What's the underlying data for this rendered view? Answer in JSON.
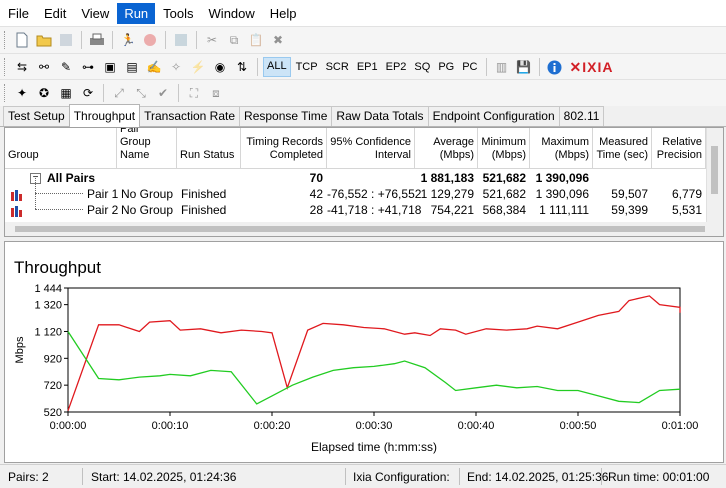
{
  "menu": [
    "File",
    "Edit",
    "View",
    "Run",
    "Tools",
    "Window",
    "Help"
  ],
  "toolbar2": {
    "all": "ALL",
    "tcp": "TCP",
    "scr": "SCR",
    "ep1": "EP1",
    "ep2": "EP2",
    "sq": "SQ",
    "pg": "PG",
    "pc": "PC",
    "brand": "IXIA"
  },
  "tabs": [
    "Test Setup",
    "Throughput",
    "Transaction Rate",
    "Response Time",
    "Raw Data Totals",
    "Endpoint Configuration",
    "802.11"
  ],
  "table": {
    "headers": {
      "group": "Group",
      "pair_group_name": "Pair Group Name",
      "run_status": "Run Status",
      "timing_records": "Timing Records Completed",
      "confidence": "95% Confidence Interval",
      "average": "Average (Mbps)",
      "minimum": "Minimum (Mbps)",
      "maximum": "Maximum (Mbps)",
      "measured_time": "Measured Time (sec)",
      "relative_precision": "Relative Precision"
    },
    "all_pairs": {
      "expander": "−",
      "label": "All Pairs",
      "timing_records": "70",
      "average": "1 881,183",
      "minimum": "521,682",
      "maximum": "1 390,096"
    },
    "pairs": [
      {
        "name": "Pair 1",
        "pair_group": "No Group",
        "status": "Finished",
        "records": "42",
        "confidence": "-76,552 : +76,552",
        "average": "1 129,279",
        "minimum": "521,682",
        "maximum": "1 390,096",
        "measured": "59,507",
        "precision": "6,779"
      },
      {
        "name": "Pair 2",
        "pair_group": "No Group",
        "status": "Finished",
        "records": "28",
        "confidence": "-41,718 : +41,718",
        "average": "754,221",
        "minimum": "568,384",
        "maximum": "1 111,111",
        "measured": "59,399",
        "precision": "5,531"
      }
    ]
  },
  "chart_data": {
    "type": "line",
    "title": "Throughput",
    "xlabel": "Elapsed time (h:mm:ss)",
    "ylabel": "Mbps",
    "xlim": [
      0,
      60
    ],
    "ylim": [
      520,
      1444
    ],
    "y_ticks": [
      "1 444",
      "1 320",
      "1 120",
      "920",
      "720",
      "520"
    ],
    "y_tick_values": [
      1444,
      1320,
      1120,
      920,
      720,
      520
    ],
    "x_ticks": [
      "0:00:00",
      "0:00:10",
      "0:00:20",
      "0:00:30",
      "0:00:40",
      "0:00:50",
      "0:01:00"
    ],
    "x_tick_values": [
      0,
      10,
      20,
      30,
      40,
      50,
      60
    ],
    "grid": false,
    "series": [
      {
        "color": "#e0191e",
        "points": [
          [
            0,
            530
          ],
          [
            3,
            1170
          ],
          [
            5,
            1170
          ],
          [
            7,
            1120
          ],
          [
            8,
            1190
          ],
          [
            10,
            1200
          ],
          [
            11,
            1130
          ],
          [
            13,
            1140
          ],
          [
            15,
            1110
          ],
          [
            17,
            1130
          ],
          [
            19,
            1120
          ],
          [
            20,
            1110
          ],
          [
            21.5,
            700
          ],
          [
            23.5,
            1130
          ],
          [
            25,
            1180
          ],
          [
            27,
            1170
          ],
          [
            29,
            1150
          ],
          [
            31,
            1140
          ],
          [
            33,
            1100
          ],
          [
            34,
            1110
          ],
          [
            35.5,
            1090
          ],
          [
            36.5,
            1140
          ],
          [
            38,
            1130
          ],
          [
            39,
            1100
          ],
          [
            41,
            1140
          ],
          [
            43,
            1130
          ],
          [
            45,
            1140
          ],
          [
            46,
            1160
          ],
          [
            48,
            1140
          ],
          [
            50,
            1190
          ],
          [
            52,
            1240
          ],
          [
            54,
            1270
          ],
          [
            55,
            1350
          ],
          [
            57,
            1385
          ],
          [
            58,
            1320
          ],
          [
            60,
            1300
          ],
          [
            62,
            1260
          ],
          [
            63.5,
            1260
          ]
        ]
      },
      {
        "color": "#22cc22",
        "points": [
          [
            0,
            1120
          ],
          [
            3,
            770
          ],
          [
            5,
            760
          ],
          [
            7,
            780
          ],
          [
            9,
            790
          ],
          [
            10,
            800
          ],
          [
            12,
            790
          ],
          [
            14,
            830
          ],
          [
            16,
            820
          ],
          [
            18.5,
            580
          ],
          [
            20,
            640
          ],
          [
            22,
            720
          ],
          [
            24,
            780
          ],
          [
            26,
            830
          ],
          [
            28,
            850
          ],
          [
            30,
            860
          ],
          [
            32,
            880
          ],
          [
            33,
            900
          ],
          [
            35,
            850
          ],
          [
            37,
            740
          ],
          [
            38,
            680
          ],
          [
            40,
            700
          ],
          [
            42,
            720
          ],
          [
            44,
            700
          ],
          [
            46,
            710
          ],
          [
            48,
            680
          ],
          [
            50,
            680
          ],
          [
            52,
            640
          ],
          [
            54,
            600
          ],
          [
            56,
            590
          ],
          [
            58,
            680
          ],
          [
            60,
            690
          ],
          [
            62,
            690
          ],
          [
            63.5,
            690
          ]
        ]
      }
    ]
  },
  "status": {
    "pairs": "Pairs: 2",
    "start": "Start: 14.02.2025, 01:24:36",
    "ixia_config": "Ixia Configuration:",
    "end": "End: 14.02.2025, 01:25:36",
    "run_time": "Run time: 00:01:00"
  },
  "colors": {
    "accent": "#0a64d2",
    "ixia_red": "#d21f26",
    "pair_icon_red": "#cc2b2b",
    "pair_icon_blue": "#1f4fa8"
  }
}
